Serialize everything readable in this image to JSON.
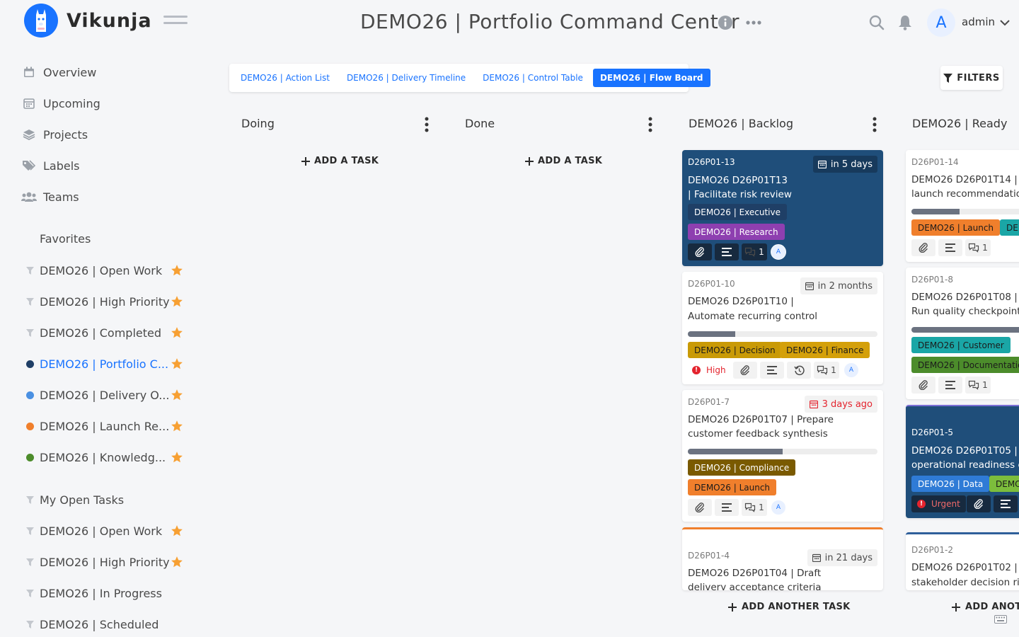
{
  "app": {
    "name": "Vikunja"
  },
  "header": {
    "title": "DEMO26 | Portfolio Command Center",
    "user_initial": "A",
    "user_name": "admin"
  },
  "sidebar": {
    "nav": [
      {
        "label": "Overview",
        "icon": "calendar-check-icon"
      },
      {
        "label": "Upcoming",
        "icon": "calendar-icon"
      },
      {
        "label": "Projects",
        "icon": "layers-icon"
      },
      {
        "label": "Labels",
        "icon": "tags-icon"
      },
      {
        "label": "Teams",
        "icon": "users-icon"
      }
    ],
    "favorites_header": "Favorites",
    "projects": [
      {
        "label": "DEMO26 | Open Work",
        "type": "filter",
        "starred": true
      },
      {
        "label": "DEMO26 | High Priority",
        "type": "filter",
        "starred": true
      },
      {
        "label": "DEMO26 | Completed",
        "type": "filter",
        "starred": true
      },
      {
        "label": "DEMO26 | Portfolio C...",
        "type": "dot",
        "color": "#1f3f66",
        "starred": true,
        "active": true
      },
      {
        "label": "DEMO26 | Delivery O...",
        "type": "dot",
        "color": "#4a90e2",
        "starred": true
      },
      {
        "label": "DEMO26 | Launch Re...",
        "type": "dot",
        "color": "#f07f2c",
        "starred": true
      },
      {
        "label": "DEMO26 | Knowledg...",
        "type": "dot",
        "color": "#4c8c2b",
        "starred": true
      },
      {
        "label": "My Open Tasks",
        "type": "filter",
        "starred": false
      },
      {
        "label": "DEMO26 | Open Work",
        "type": "filter",
        "starred": true
      },
      {
        "label": "DEMO26 | High Priority",
        "type": "filter",
        "starred": true
      },
      {
        "label": "DEMO26 | In Progress",
        "type": "filter",
        "starred": false
      },
      {
        "label": "DEMO26 | Scheduled",
        "type": "filter",
        "starred": false
      }
    ]
  },
  "views": {
    "tabs": [
      "DEMO26 | Action List",
      "DEMO26 | Delivery Timeline",
      "DEMO26 | Control Table",
      "DEMO26 | Flow Board"
    ],
    "active": 3,
    "filters_label": "FILTERS"
  },
  "board": {
    "add_task_label": "ADD A TASK",
    "add_another_label": "ADD ANOTHER TASK",
    "add_another_truncated": "ADD ANOTI",
    "buckets": [
      {
        "title": "Doing"
      },
      {
        "title": "Done"
      },
      {
        "title": "DEMO26 | Backlog"
      },
      {
        "title": "DEMO26 | Ready"
      }
    ],
    "cards": {
      "c13": {
        "id": "D26P01-13",
        "title_l1": "DEMO26 D26P01T13",
        "title_l2": "| Facilitate risk review",
        "due": "in 5 days",
        "labels": [
          "DEMO26 | Executive",
          "DEMO26 | Research"
        ],
        "comments": "1",
        "assignee": "A"
      },
      "c10": {
        "id": "D26P01-10",
        "title_l1": "DEMO26 D26P01T10 |",
        "title_l2": "Automate recurring control",
        "due": "in 2 months",
        "progress": 0.25,
        "labels": [
          "DEMO26 | Decision",
          "DEMO26 | Finance"
        ],
        "priority": "High",
        "comments": "1",
        "assignee": "A"
      },
      "c7": {
        "id": "D26P01-7",
        "title_l1": "DEMO26 D26P01T07 | Prepare",
        "title_l2": "customer feedback synthesis",
        "due": "3 days ago",
        "progress": 0.5,
        "labels": [
          "DEMO26 | Compliance",
          "DEMO26 | Launch"
        ],
        "comments": "1",
        "assignee": "A"
      },
      "c4": {
        "id": "D26P01-4",
        "title_l1": "DEMO26 D26P01T04 | Draft",
        "title_l2": "delivery acceptance criteria",
        "due": "in 21 days"
      },
      "c14": {
        "id": "D26P01-14",
        "title_l1": "DEMO26 D26P01T14 | A",
        "title_l2": "launch recommendation",
        "progress": 0.25,
        "labels": [
          "DEMO26 | Launch",
          "DE"
        ],
        "comments": "1"
      },
      "c8": {
        "id": "D26P01-8",
        "title_l1": "DEMO26 D26P01T08 |",
        "title_l2": "Run quality checkpoint",
        "progress": 0.5,
        "labels": [
          "DEMO26 | Customer",
          "DEMO26 | Documentatio"
        ],
        "comments": "1"
      },
      "c5": {
        "id": "D26P01-5",
        "title_l1": "DEMO26 D26P01T05 | R",
        "title_l2": "operational readiness ev",
        "labels": [
          "DEMO26 | Data",
          "DEMO"
        ],
        "priority": "Urgent"
      },
      "c2": {
        "id": "D26P01-2",
        "title_l1": "DEMO26 D26P01T02 | M",
        "title_l2": "stakeholder decision rig"
      }
    }
  },
  "colors": {
    "accent": "#1973ff",
    "card_dark": "#1f4e7a",
    "label_executive": "#1f3f66",
    "label_research": "#8e3fb0",
    "label_decision": "#c99a06",
    "label_finance": "#d4a00a",
    "label_compliance": "#7a5a00",
    "label_launch": "#f07f2c",
    "label_customer": "#1aa6a6",
    "label_documentation": "#4c8c2b",
    "label_data": "#2f7bd6",
    "label_demo_green": "#7cbd3c",
    "danger": "#e4242e",
    "star": "#f7a033"
  }
}
